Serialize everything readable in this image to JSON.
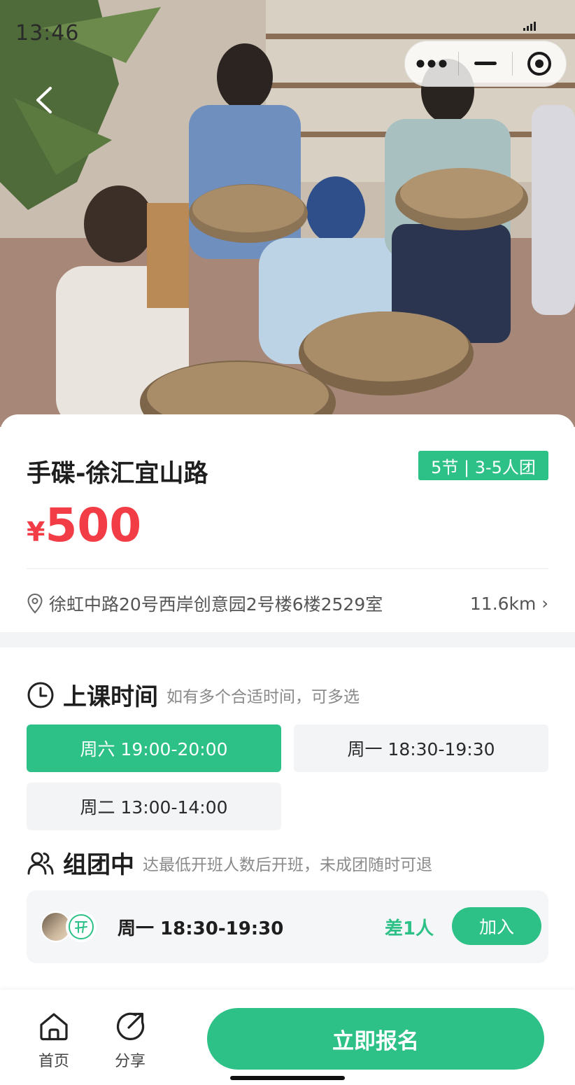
{
  "status_bar": {
    "time": "13:46"
  },
  "hero": {
    "photo_icon": "hero-photo"
  },
  "course": {
    "title": "手碟-徐汇宜山路",
    "tag": "5节 | 3-5人团",
    "price_currency": "¥",
    "price_value": "500",
    "address": "徐虹中路20号西岸创意园2号楼6楼2529室",
    "distance": "11.6km",
    "distance_arrow": "›"
  },
  "schedule": {
    "heading": "上课时间",
    "subheading": "如有多个合适时间，可多选",
    "slots": [
      {
        "label": "周六 19:00-20:00",
        "selected": true
      },
      {
        "label": "周一 18:30-19:30",
        "selected": false
      },
      {
        "label": "周二 13:00-14:00",
        "selected": false
      }
    ]
  },
  "group": {
    "heading": "组团中",
    "subheading": "达最低开班人数后开班，未成团随时可退",
    "time": "周一 18:30-19:30",
    "need": "差1人",
    "join_label": "加入"
  },
  "bottom_bar": {
    "home_label": "首页",
    "share_label": "分享",
    "signup_label": "立即报名"
  },
  "colors": {
    "accent": "#2ec187",
    "price": "#f23d46"
  }
}
